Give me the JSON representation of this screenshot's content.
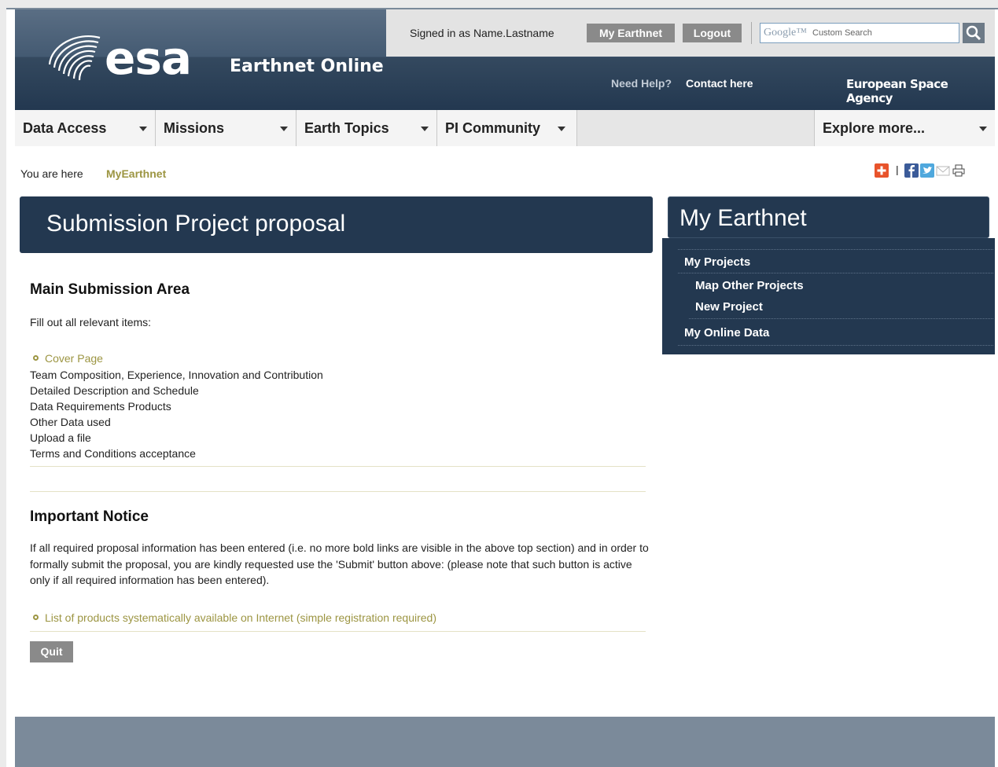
{
  "header": {
    "logo_text": "esa",
    "site_title": "Earthnet Online",
    "signed_in": "Signed in as Name.Lastname",
    "my_earthnet_button": "My Earthnet",
    "logout_button": "Logout",
    "search_brand": "Google™",
    "search_placeholder": "Custom Search",
    "need_help": "Need Help?",
    "contact": "Contact here",
    "agency": "European Space Agency"
  },
  "nav": {
    "items": [
      "Data Access",
      "Missions",
      "Earth Topics",
      "PI Community"
    ],
    "explore": "Explore more..."
  },
  "breadcrumb": {
    "label": "You are here",
    "current": "MyEarthnet"
  },
  "main": {
    "title": "Submission Project proposal",
    "section1_heading": "Main Submission Area",
    "instruction": "Fill out all relevant items:",
    "cover_page_link": "Cover Page",
    "items": [
      "Team Composition, Experience, Innovation and Contribution",
      "Detailed Description and Schedule",
      "Data Requirements Products",
      "Other Data used",
      "Upload a file",
      "Terms and Conditions acceptance"
    ],
    "section2_heading": "Important Notice",
    "notice": "If all required proposal information has been entered (i.e. no more bold links are visible in the above top section) and in order to formally submit the proposal, you are kindly requested use the 'Submit' button above: (please note that such button is active only if all required information has been entered).",
    "products_link": "List of products systematically available on Internet (simple registration required)",
    "quit_button": "Quit"
  },
  "sidebar": {
    "title": "My Earthnet",
    "my_projects": "My Projects",
    "map_other_projects": "Map Other Projects",
    "new_project": "New Project",
    "my_online_data": "My Online Data"
  },
  "colors": {
    "header_dark": "#233850",
    "accent_link": "#9c9542",
    "button_grey": "#8a8a8a"
  }
}
